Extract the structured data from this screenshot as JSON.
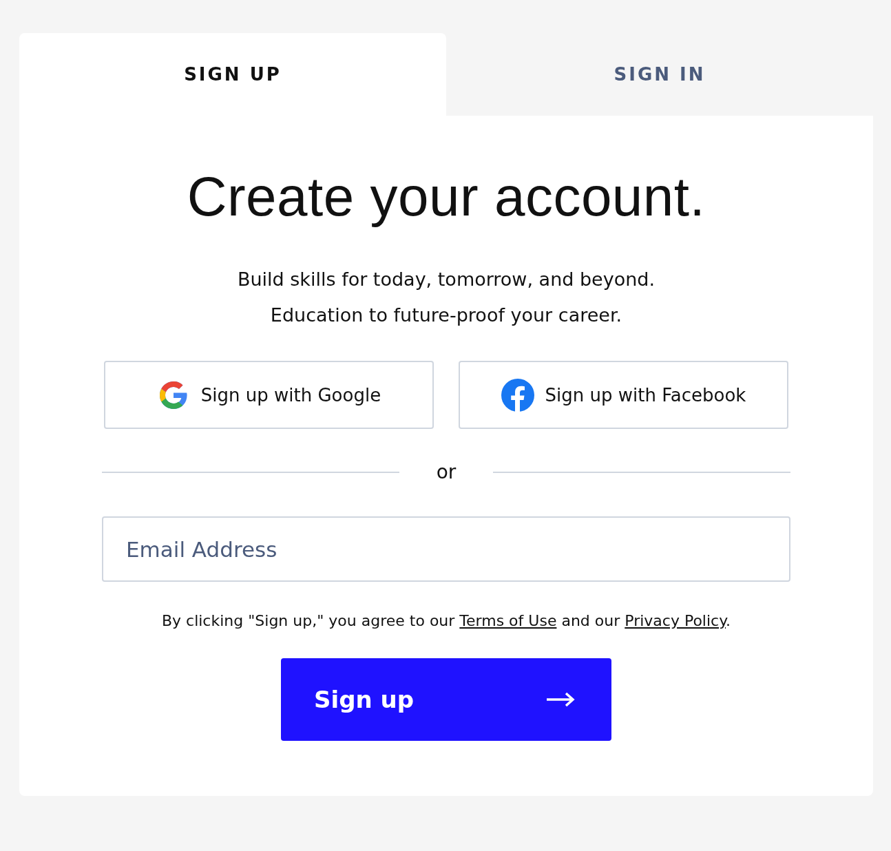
{
  "tabs": [
    {
      "label": "SIGN UP",
      "selected": true
    },
    {
      "label": "SIGN IN",
      "selected": false
    }
  ],
  "title": "Create your account.",
  "subtitle": [
    "Build skills for today, tomorrow, and beyond.",
    "Education to future-proof your career."
  ],
  "social_buttons": [
    {
      "label": "Sign up with Google",
      "kind": "google"
    },
    {
      "label": "Sign up with Facebook",
      "kind": "facebook"
    }
  ],
  "divider_text": "or",
  "email": {
    "placeholder": "Email Address"
  },
  "terms": [
    {
      "kind": "text",
      "text": "By clicking \"Sign up,\" you agree to our "
    },
    {
      "kind": "link",
      "text": "Terms of Use"
    },
    {
      "kind": "text",
      "text": " and our "
    },
    {
      "kind": "link",
      "text": "Privacy Policy"
    },
    {
      "kind": "text",
      "text": "."
    }
  ],
  "submit": {
    "label": "Sign up"
  }
}
